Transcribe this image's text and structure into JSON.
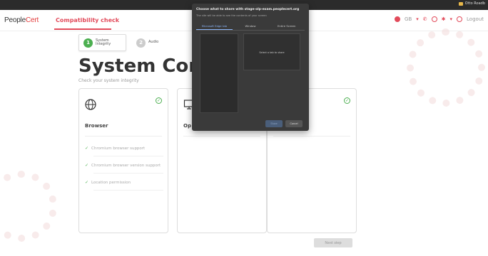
{
  "os_bar": {
    "right_label": "Otto Roadb"
  },
  "header": {
    "logo_main": "People",
    "logo_accent": "Cert",
    "nav_tab": "Compatibility check",
    "language": "GB",
    "logout": "Logout"
  },
  "stepper": {
    "steps": [
      {
        "number": "1",
        "label": "System Integrity"
      },
      {
        "number": "2",
        "label": "Audio"
      }
    ]
  },
  "page": {
    "title": "System Comp",
    "subtitle": "Check your system integrity"
  },
  "cards": [
    {
      "title": "Browser",
      "icon": "globe-icon",
      "checks": [
        "Chromium browser support",
        "Chromium browser version support",
        "Location permission"
      ]
    },
    {
      "title": "Op",
      "icon": "computer-icon",
      "checks": []
    },
    {
      "title": "",
      "icon": "",
      "checks": []
    }
  ],
  "next_button": "Next step",
  "share_dialog": {
    "title": "Choose what to share with stage-olp-exam.peoplecert.org",
    "subtitle": "The site will be able to see the contents of your screen",
    "tabs": [
      "Microsoft Edge tab",
      "Window",
      "Entire Screen"
    ],
    "active_tab": 0,
    "preview_text": "Select a tab to share",
    "share_label": "Share",
    "cancel_label": "Cancel"
  },
  "colors": {
    "accent": "#e24a5a",
    "success": "#4caf50",
    "dialog_bg": "#3a3a3a"
  }
}
